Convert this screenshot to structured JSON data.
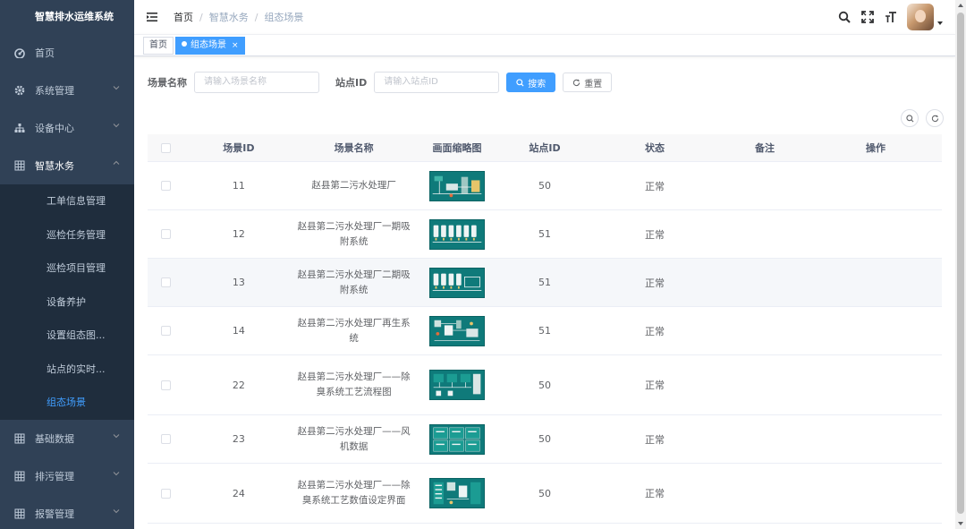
{
  "sidebar": {
    "brand": "智慧排水运维系统",
    "items": [
      {
        "label": "首页",
        "icon": "dashboard-icon"
      },
      {
        "label": "系统管理",
        "icon": "gear-icon"
      },
      {
        "label": "设备中心",
        "icon": "sitemap-icon"
      },
      {
        "label": "智慧水务",
        "icon": "grid-icon"
      }
    ],
    "sub_items": [
      {
        "label": "工单信息管理"
      },
      {
        "label": "巡检任务管理"
      },
      {
        "label": "巡检项目管理"
      },
      {
        "label": "设备养护"
      },
      {
        "label": "设置组态图..."
      },
      {
        "label": "站点的实时..."
      },
      {
        "label": "组态场景"
      }
    ],
    "bottom_items": [
      {
        "label": "基础数据",
        "icon": "grid-icon"
      },
      {
        "label": "排污管理",
        "icon": "grid-icon"
      },
      {
        "label": "报警管理",
        "icon": "grid-icon"
      }
    ]
  },
  "header": {
    "breadcrumb": [
      "首页",
      "智慧水务",
      "组态场景"
    ]
  },
  "tags": {
    "home": "首页",
    "active": "组态场景",
    "close": "×"
  },
  "search": {
    "scene_name_label": "场景名称",
    "scene_name_placeholder": "请输入场景名称",
    "site_id_label": "站点ID",
    "site_id_placeholder": "请输入站点ID",
    "search_button": "搜索",
    "reset_button": "重置"
  },
  "table": {
    "columns": [
      "场景ID",
      "场景名称",
      "画面缩略图",
      "站点ID",
      "状态",
      "备注",
      "操作"
    ],
    "rows": [
      {
        "id": "11",
        "name": "赵县第二污水处理厂",
        "site": "50",
        "status": "正常",
        "note": "",
        "thumb": "plant"
      },
      {
        "id": "12",
        "name": "赵县第二污水处理厂一期吸附系统",
        "site": "51",
        "status": "正常",
        "note": "",
        "thumb": "tanks6"
      },
      {
        "id": "13",
        "name": "赵县第二污水处理厂二期吸附系统",
        "site": "51",
        "status": "正常",
        "note": "",
        "thumb": "tanks4"
      },
      {
        "id": "14",
        "name": "赵县第二污水处理厂再生系统",
        "site": "51",
        "status": "正常",
        "note": "",
        "thumb": "regen"
      },
      {
        "id": "22",
        "name": "赵县第二污水处理厂——除臭系统工艺流程图",
        "site": "50",
        "status": "正常",
        "note": "",
        "thumb": "flow"
      },
      {
        "id": "23",
        "name": "赵县第二污水处理厂——风机数据",
        "site": "50",
        "status": "正常",
        "note": "",
        "thumb": "fan"
      },
      {
        "id": "24",
        "name": "赵县第二污水处理厂——除臭系统工艺数值设定界面",
        "site": "50",
        "status": "正常",
        "note": "",
        "thumb": "settings"
      }
    ]
  },
  "colors": {
    "sidebar_bg": "#304156",
    "submenu_bg": "#1f2d3d",
    "accent": "#409eff",
    "thumb_teal": "#0e7d7d"
  }
}
